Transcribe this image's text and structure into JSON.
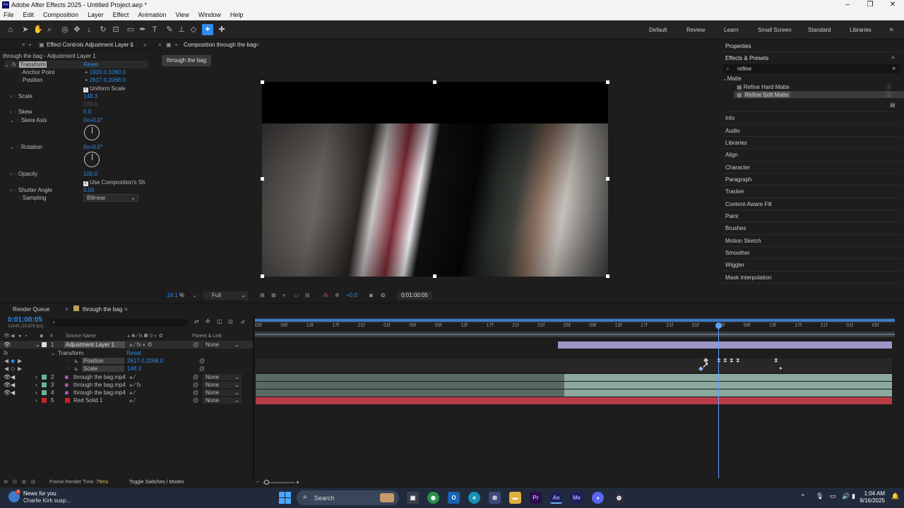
{
  "window": {
    "title": "Adobe After Effects 2025 - Untitled Project.aep *"
  },
  "menu": [
    "File",
    "Edit",
    "Composition",
    "Layer",
    "Effect",
    "Animation",
    "View",
    "Window",
    "Help"
  ],
  "workspaces": [
    "Default",
    "Review",
    "Learn",
    "Small Screen",
    "Standard",
    "Libraries"
  ],
  "effect_controls": {
    "tab": "Effect Controls Adjustment Layer 1",
    "subtitle": "through the bag - Adjustment Layer 1",
    "effect": "Transform",
    "reset": "Reset",
    "props": {
      "anchor_label": "Anchor Point",
      "anchor_value": "1920.0,1080.0",
      "position_label": "Position",
      "position_value": "2617.0,2068.0",
      "uniform_label": "Uniform Scale",
      "scale_label": "Scale",
      "scale_value": "148.3",
      "scale_width": "100.0",
      "skew_label": "Skew",
      "skew_value": "0.0",
      "skew_axis_label": "Skew Axis",
      "skew_axis_value": "0x+0.0°",
      "rotation_label": "Rotation",
      "rotation_value": "0x+0.0°",
      "opacity_label": "Opacity",
      "opacity_value": "100.0",
      "use_comp_label": "Use Composition's Sh",
      "shutter_label": "Shutter Angle",
      "shutter_value": "0.00",
      "sampling_label": "Sampling",
      "sampling_value": "Bilinear"
    }
  },
  "composition": {
    "tab": "Composition through the bag",
    "crumb": "through the bag",
    "zoom": "19.1",
    "zoom_unit": "%",
    "resolution": "Full",
    "exposure": "+0.0",
    "timecode": "0:01:00:05"
  },
  "right_panel": {
    "properties": "Properties",
    "effects_presets": "Effects & Presets",
    "search_value": "refine",
    "folder": "Matte",
    "items": [
      "Refine Hard Matte",
      "Refine Soft Matte"
    ],
    "panels": [
      "Info",
      "Audio",
      "Libraries",
      "Align",
      "Character",
      "Paragraph",
      "Tracker",
      "Content-Aware Fill",
      "Paint",
      "Brushes",
      "Motion Sketch",
      "Smoother",
      "Wiggler",
      "Mask Interpolation"
    ]
  },
  "timeline": {
    "tabs": [
      "Render Queue",
      "through the bag"
    ],
    "timecode": "0:01:00:05",
    "frames": "01445 (23.976 fps)",
    "col_num": "#",
    "col_source": "Source Name",
    "col_parent": "Parent & Link",
    "layers": [
      {
        "num": "1",
        "name": "Adjustment Layer 1",
        "parent": "None",
        "color": "#e0e0e0"
      },
      {
        "num": "2",
        "name": "through the bag.mp4",
        "parent": "None",
        "color": "#6ab2a2"
      },
      {
        "num": "3",
        "name": "through the bag.mp4",
        "parent": "None",
        "color": "#6ab2a2"
      },
      {
        "num": "4",
        "name": "through the bag.mp4",
        "parent": "None",
        "color": "#6ab2a2"
      },
      {
        "num": "5",
        "name": "Red Solid 1",
        "parent": "None",
        "color": "#d02020"
      }
    ],
    "transform_label": "Transform",
    "reset": "Reset",
    "position_label": "Position",
    "position_value": "2617.0,2068.0",
    "scale_label": "Scale",
    "scale_value": "148.3",
    "ruler": [
      "05f",
      "09f",
      "13f",
      "17f",
      "21f",
      "01f",
      "05f",
      "09f",
      "13f",
      "17f",
      "21f",
      "01f",
      "05f",
      "09f",
      "13f",
      "17f",
      "21f",
      "01f",
      "05f",
      "09f",
      "13f",
      "17f",
      "21f",
      "01f",
      "05f"
    ],
    "footer_render_label": "Frame Render Time:",
    "footer_render_value": "79ms",
    "footer_toggle": "Toggle Switches / Modes"
  },
  "taskbar": {
    "news_title": "News for you",
    "news_sub": "Charlie Kirk susp...",
    "search": "Search",
    "time": "1:04 AM",
    "date": "9/16/2025"
  },
  "colors": {
    "accent": "#2d8ceb",
    "adjustment_bar": "#9a96c8",
    "footage_bar": "#8aa89e",
    "solid_bar": "#b83c46"
  }
}
